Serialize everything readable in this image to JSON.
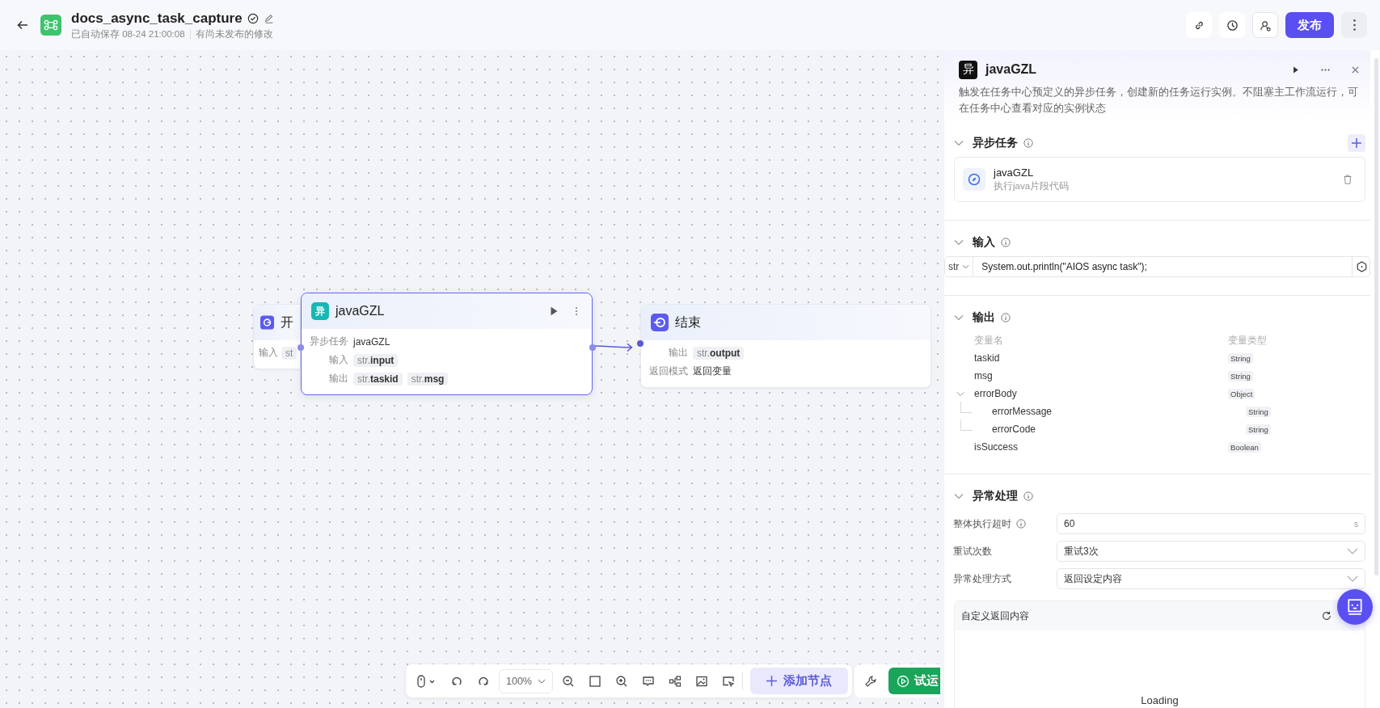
{
  "header": {
    "title": "docs_async_task_capture",
    "saved": "已自动保存 08-24 21:00:08",
    "status": "有尚未发布的修改",
    "publish": "发布"
  },
  "canvas": {
    "nodes": [
      {
        "kind": "start",
        "title": "开",
        "selected": false,
        "rows": [
          {
            "label": "输入",
            "tags": [
              {
                "type": "st"
              }
            ]
          }
        ]
      },
      {
        "kind": "async",
        "badge": "异",
        "title": "javaGZL",
        "selected": true,
        "rows": [
          {
            "label": "异步任务",
            "value": "javaGZL"
          },
          {
            "label": "输入",
            "tags": [
              {
                "type": "str.",
                "name": "input"
              }
            ]
          },
          {
            "label": "输出",
            "tags": [
              {
                "type": "str.",
                "name": "taskid"
              },
              {
                "type": "str.",
                "name": "msg"
              }
            ]
          }
        ]
      },
      {
        "kind": "end",
        "title": "结束",
        "selected": false,
        "rows": [
          {
            "label": "输出",
            "tags": [
              {
                "type": "str.",
                "name": "output"
              }
            ]
          },
          {
            "label": "返回模式",
            "value": "返回变量"
          }
        ]
      }
    ]
  },
  "toolbar": {
    "zoom": "100%",
    "add_node": "添加节点",
    "run": "试运"
  },
  "panel": {
    "badge": "异",
    "title": "javaGZL",
    "description": "触发在任务中心预定义的异步任务，创建新的任务运行实例。不阻塞主工作流运行，可在任务中心查看对应的实例状态",
    "tasks": {
      "title": "异步任务",
      "items": [
        {
          "name": "javaGZL",
          "desc": "执行java片段代码"
        }
      ]
    },
    "input": {
      "title": "输入",
      "type": "str",
      "value": "System.out.println(\"AIOS async task\");"
    },
    "output": {
      "title": "输出",
      "columns": [
        "变量名",
        "变量类型"
      ],
      "variables": [
        {
          "name": "taskid",
          "type": "String"
        },
        {
          "name": "msg",
          "type": "String"
        },
        {
          "name": "errorBody",
          "type": "Object",
          "expanded": true,
          "children": [
            {
              "name": "errorMessage",
              "type": "String"
            },
            {
              "name": "errorCode",
              "type": "String"
            }
          ]
        },
        {
          "name": "isSuccess",
          "type": "Boolean"
        }
      ]
    },
    "error": {
      "title": "异常处理",
      "fields": [
        {
          "kind": "number",
          "label": "整体执行超时",
          "info": true,
          "value": "60",
          "unit": "s"
        },
        {
          "kind": "select",
          "label": "重试次数",
          "info": false,
          "value": "重试3次"
        },
        {
          "kind": "select",
          "label": "异常处理方式",
          "info": false,
          "value": "返回设定内容"
        }
      ],
      "custom": {
        "title": "自定义返回内容",
        "loading": "Loading"
      }
    }
  }
}
